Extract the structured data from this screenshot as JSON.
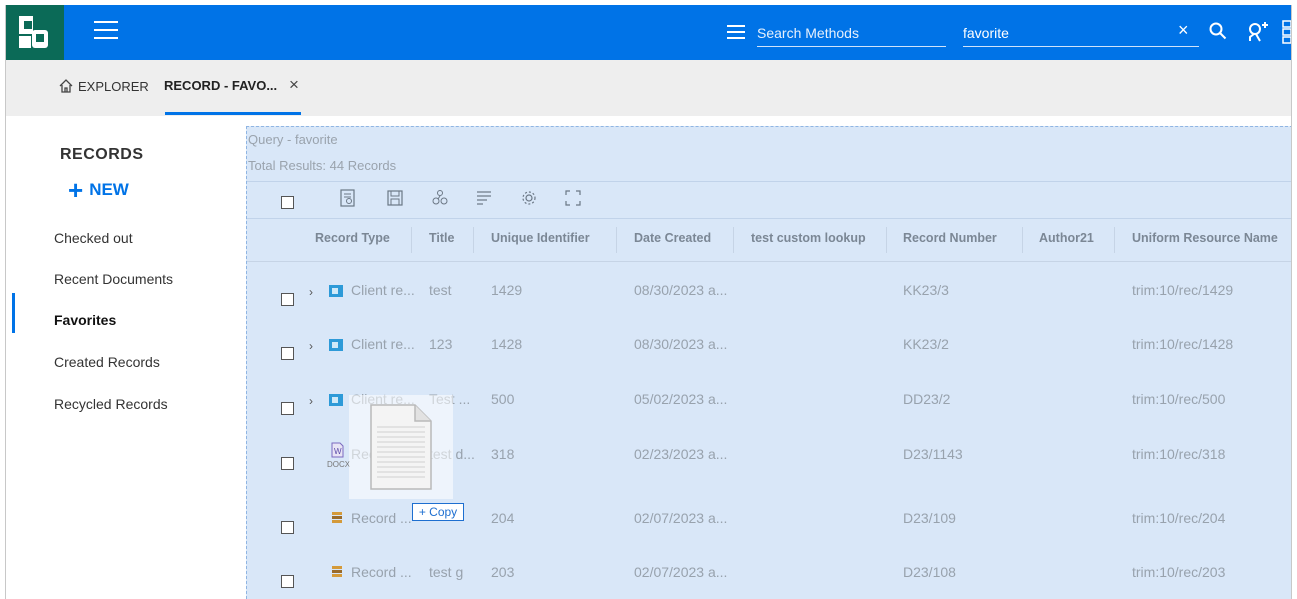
{
  "header": {
    "search_methods_placeholder": "Search Methods",
    "query_value": "favorite",
    "clear_symbol": "×"
  },
  "tabs": {
    "explorer_label": "EXPLORER",
    "record_label": "RECORD - FAVO...",
    "close_symbol": "×"
  },
  "sidebar": {
    "title": "RECORDS",
    "new_label": "NEW",
    "new_plus": "+",
    "items": [
      {
        "label": "Checked out"
      },
      {
        "label": "Recent Documents"
      },
      {
        "label": "Favorites",
        "active": true
      },
      {
        "label": "Created Records"
      },
      {
        "label": "Recycled Records"
      }
    ]
  },
  "main": {
    "query_text": "Query - favorite",
    "total_text": "Total Results: 44 Records",
    "toolbar_icons": [
      "view-properties-icon",
      "save-icon",
      "link-icon",
      "wrap-text-icon",
      "settings-icon",
      "expand-icon"
    ],
    "columns": [
      "Record Type",
      "Title",
      "Unique Identifier",
      "Date Created",
      "test custom lookup",
      "Record Number",
      "Author21",
      "Uniform Resource Name"
    ],
    "rows": [
      {
        "type": "Client re...",
        "icon": "client-record-icon",
        "expandable": true,
        "title": "test",
        "uid": "1429",
        "date": "08/30/2023 a...",
        "lookup": "",
        "number": "KK23/3",
        "author": "",
        "urn": "trim:10/rec/1429"
      },
      {
        "type": "Client re...",
        "icon": "client-record-icon",
        "expandable": true,
        "title": "123",
        "uid": "1428",
        "date": "08/30/2023 a...",
        "lookup": "",
        "number": "KK23/2",
        "author": "",
        "urn": "trim:10/rec/1428"
      },
      {
        "type": "Client re...",
        "icon": "client-record-icon",
        "expandable": true,
        "title": "Test ...",
        "uid": "500",
        "date": "05/02/2023 a...",
        "lookup": "",
        "number": "DD23/2",
        "author": "",
        "urn": "trim:10/rec/500"
      },
      {
        "type": "Record ...",
        "icon": "docx-file-icon",
        "icon_label": "DOCX",
        "expandable": false,
        "title": "test d...",
        "uid": "318",
        "date": "02/23/2023 a...",
        "lookup": "",
        "number": "D23/1143",
        "author": "",
        "urn": "trim:10/rec/318"
      },
      {
        "type": "Record ...",
        "icon": "record-document-icon",
        "expandable": false,
        "title": "",
        "uid": "204",
        "date": "02/07/2023 a...",
        "lookup": "",
        "number": "D23/109",
        "author": "",
        "urn": "trim:10/rec/204"
      },
      {
        "type": "Record ...",
        "icon": "record-document-icon",
        "expandable": false,
        "title": "test g",
        "uid": "203",
        "date": "02/07/2023 a...",
        "lookup": "",
        "number": "D23/108",
        "author": "",
        "urn": "trim:10/rec/203"
      }
    ],
    "chevron": "›"
  },
  "drag": {
    "copy_label": "+ Copy"
  },
  "colors": {
    "topbar": "#0073e7",
    "logo_bg": "#0b6a57",
    "selection_bg": "#d9e7f8",
    "accent": "#0073e7"
  }
}
